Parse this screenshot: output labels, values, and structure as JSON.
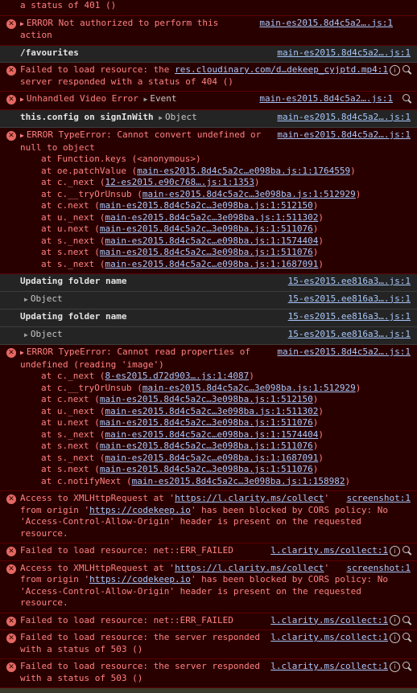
{
  "colors": {
    "background": "#242424",
    "error_background": "#290000",
    "error_text": "#ff8080",
    "link": "#a8c7fa"
  },
  "rows": {
    "r0": {
      "text": "a status of 401 ()"
    },
    "r1": {
      "prefix": "ERROR",
      "text": "Not authorized to perform this action",
      "source": "main-es2015.8d4c5a2….js:1"
    },
    "r2": {
      "text": "/favourites",
      "source": "main-es2015.8d4c5a2….js:1"
    },
    "r3": {
      "text": "Failed to load resource: the server responded with a status of 404 ()",
      "source": "res.cloudinary.com/d…dekeep_cyjptd.mp4:1"
    },
    "r4": {
      "text": "Unhandled Video Error",
      "object": "Event",
      "source": "main-es2015.8d4c5a2….js:1"
    },
    "r5": {
      "text": "this.config on signInWith",
      "object": "Object",
      "source": "main-es2015.8d4c5a2….js:1"
    },
    "r6": {
      "prefix": "ERROR",
      "text": "TypeError: Cannot convert undefined or null to object",
      "source": "main-es2015.8d4c5a2….js:1",
      "trace": [
        {
          "fn": "at Function.keys (<anonymous>)",
          "link": ""
        },
        {
          "fn": "at oe.patchValue (",
          "link": "main-es2015.8d4c5a2c…e098ba.js:1:1764559"
        },
        {
          "fn": "at c._next (",
          "link": "12-es2015.e90c768….js:1:1353"
        },
        {
          "fn": "at c.__tryOrUnsub (",
          "link": "main-es2015.8d4c5a2c…3e098ba.js:1:512929"
        },
        {
          "fn": "at c.next (",
          "link": "main-es2015.8d4c5a2c…3e098ba.js:1:512150"
        },
        {
          "fn": "at u._next (",
          "link": "main-es2015.8d4c5a2c…3e098ba.js:1:511302"
        },
        {
          "fn": "at u.next (",
          "link": "main-es2015.8d4c5a2c…3e098ba.js:1:511076"
        },
        {
          "fn": "at s._next (",
          "link": "main-es2015.8d4c5a2c…e098ba.js:1:1574404"
        },
        {
          "fn": "at s.next (",
          "link": "main-es2015.8d4c5a2c…3e098ba.js:1:511076"
        },
        {
          "fn": "at s._next (",
          "link": "main-es2015.8d4c5a2c…e098ba.js:1:1687091"
        }
      ]
    },
    "r7": {
      "text": "Updating folder name",
      "source": "15-es2015.ee816a3….js:1"
    },
    "r8": {
      "object": "Object",
      "source": "15-es2015.ee816a3….js:1"
    },
    "r9": {
      "text": "Updating folder name",
      "source": "15-es2015.ee816a3….js:1"
    },
    "r10": {
      "object": "Object",
      "source": "15-es2015.ee816a3….js:1"
    },
    "r11": {
      "prefix": "ERROR",
      "text": "TypeError: Cannot read properties of undefined (reading 'image')",
      "source": "main-es2015.8d4c5a2….js:1",
      "trace": [
        {
          "fn": "at c._next (",
          "link": "8-es2015.d72d903….js:1:4087"
        },
        {
          "fn": "at c.__tryOrUnsub (",
          "link": "main-es2015.8d4c5a2c…3e098ba.js:1:512929"
        },
        {
          "fn": "at c.next (",
          "link": "main-es2015.8d4c5a2c…3e098ba.js:1:512150"
        },
        {
          "fn": "at u._next (",
          "link": "main-es2015.8d4c5a2c…3e098ba.js:1:511302"
        },
        {
          "fn": "at u.next (",
          "link": "main-es2015.8d4c5a2c…3e098ba.js:1:511076"
        },
        {
          "fn": "at s._next (",
          "link": "main-es2015.8d4c5a2c…e098ba.js:1:1574404"
        },
        {
          "fn": "at s.next (",
          "link": "main-es2015.8d4c5a2c…3e098ba.js:1:511076"
        },
        {
          "fn": "at s._next (",
          "link": "main-es2015.8d4c5a2c…e098ba.js:1:1687091"
        },
        {
          "fn": "at s.next (",
          "link": "main-es2015.8d4c5a2c…3e098ba.js:1:511076"
        },
        {
          "fn": "at c.notifyNext (",
          "link": "main-es2015.8d4c5a2c…3e098ba.js:1:158982"
        }
      ]
    },
    "r12": {
      "t1": "Access to XMLHttpRequest at '",
      "url1": "https://l.clarity.ms/collect",
      "t2": "' from origin '",
      "url2": "https://codekeep.io",
      "t3": "' has been blocked by CORS policy: No 'Access-Control-Allow-Origin' header is present on the requested resource.",
      "source": "screenshot:1"
    },
    "r13": {
      "text": "Failed to load resource: net::ERR_FAILED",
      "source": "l.clarity.ms/collect:1"
    },
    "r14": {
      "t1": "Access to XMLHttpRequest at '",
      "url1": "https://l.clarity.ms/collect",
      "t2": "' from origin '",
      "url2": "https://codekeep.io",
      "t3": "' has been blocked by CORS policy: No 'Access-Control-Allow-Origin' header is present on the requested resource.",
      "source": "screenshot:1"
    },
    "r15": {
      "text": "Failed to load resource: net::ERR_FAILED",
      "source": "l.clarity.ms/collect:1"
    },
    "r16": {
      "text": "Failed to load resource: the server responded with a status of 503 ()",
      "source": "l.clarity.ms/collect:1"
    },
    "r17": {
      "text": "Failed to load resource: the server responded with a status of 503 ()",
      "source": "l.clarity.ms/collect:1"
    }
  }
}
